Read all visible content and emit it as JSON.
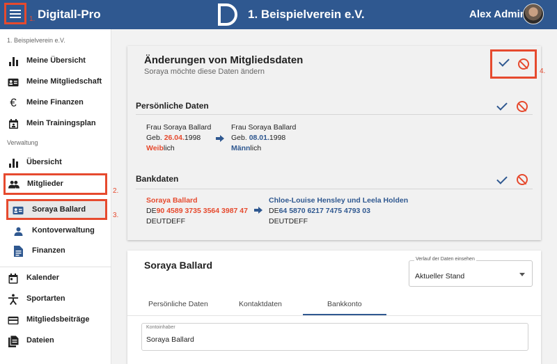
{
  "header": {
    "app_title": "Digitall-Pro",
    "club_title": "1. Beispielverein e.V.",
    "user_name": "Alex Admin",
    "menu_icon": "hamburger-menu-icon",
    "brand_color": "#2f5890",
    "annotation_color": "#e64a2e"
  },
  "annotations": [
    "1.",
    "2.",
    "3.",
    "4."
  ],
  "sidebar": {
    "club_label": "1. Beispielverein e.V.",
    "admin_label": "Verwaltung",
    "club_items": [
      {
        "label": "Meine Übersicht",
        "icon": "bar-chart-icon"
      },
      {
        "label": "Meine Mitgliedschaft",
        "icon": "id-card-icon"
      },
      {
        "label": "Meine Finanzen",
        "icon": "euro-icon"
      },
      {
        "label": "Mein Trainingsplan",
        "icon": "calendar-person-icon"
      }
    ],
    "admin_items": [
      {
        "label": "Übersicht",
        "icon": "bar-chart-icon"
      },
      {
        "label": "Mitglieder",
        "icon": "people-icon"
      },
      {
        "label": "Soraya Ballard",
        "icon": "id-card-icon"
      },
      {
        "label": "Kontoverwaltung",
        "icon": "person-icon"
      },
      {
        "label": "Finanzen",
        "icon": "document-icon"
      }
    ],
    "bottom_items": [
      {
        "label": "Kalender",
        "icon": "calendar-icon"
      },
      {
        "label": "Sportarten",
        "icon": "sport-person-icon"
      },
      {
        "label": "Mitgliedsbeiträge",
        "icon": "credit-card-icon"
      },
      {
        "label": "Dateien",
        "icon": "files-icon"
      }
    ]
  },
  "changes": {
    "title": "Änderungen von Mitgliedsdaten",
    "subtitle": "Soraya möchte diese Daten ändern",
    "personal": {
      "heading": "Persönliche Daten",
      "old_name": "Frau Soraya Ballard",
      "old_geb_prefix": "Geb. ",
      "old_geb_changed": "26.04.",
      "old_geb_suffix": "1998",
      "old_gender_changed": "Weib",
      "old_gender_suffix": "lich",
      "new_name": "Frau Soraya Ballard",
      "new_geb_prefix": "Geb. ",
      "new_geb_changed": "08.01.",
      "new_geb_suffix": "1998",
      "new_gender_changed": "Männ",
      "new_gender_suffix": "lich"
    },
    "bank": {
      "heading": "Bankdaten",
      "old_holder": "Soraya Ballard",
      "old_iban_prefix": "DE",
      "old_iban_changed": "90 4589 3735 3564 3987 47",
      "old_bic": "DEUTDEFF",
      "new_holder": "Chloe-Louise Hensley und Leela Holden",
      "new_iban_prefix": "DE",
      "new_iban_changed": "64 5870 6217 7475 4793 03",
      "new_bic": "DEUTDEFF"
    }
  },
  "member": {
    "name": "Soraya Ballard",
    "history_label": "Verlauf der Daten einsehen",
    "history_value": "Aktueller Stand",
    "tabs": [
      "Persönliche Daten",
      "Kontaktdaten",
      "Bankkonto"
    ],
    "active_tab": "Bankkonto",
    "field_label": "Kontoinhaber",
    "field_value": "Soraya Ballard"
  }
}
